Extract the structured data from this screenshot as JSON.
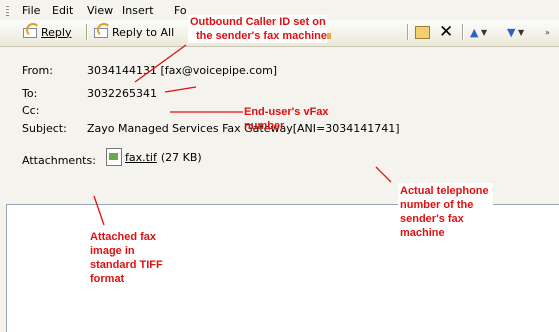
{
  "menu": [
    "File",
    "Edit",
    "View",
    "Insert",
    "Fo"
  ],
  "toolbar": {
    "reply": "Reply",
    "reply_all": "Reply to All"
  },
  "header": {
    "from_label": "From:",
    "from_value": "3034144131 [fax@voicepipe.com]",
    "to_label": "To:",
    "to_value": "3032265341",
    "cc_label": "Cc:",
    "cc_value": "",
    "subject_label": "Subject:",
    "subject_value": "Zayo Managed Services Fax Gateway[ANI=3034141741]",
    "attachments_label": "Attachments:",
    "attachment_name": "fax.tif",
    "attachment_size": "(27 KB)"
  },
  "annotations": {
    "caller_id": [
      "Outbound Caller ID set on",
      "the sender's fax machine"
    ],
    "vfax": [
      "End-user's vFax",
      "number"
    ],
    "actual_number": [
      "Actual telephone",
      "number of the",
      "sender's fax",
      "machine"
    ],
    "attached": [
      "Attached fax",
      "image in",
      "standard TIFF",
      "format"
    ]
  },
  "colors": {
    "annotation": "#e01010",
    "chrome": "#f4f3ee"
  }
}
